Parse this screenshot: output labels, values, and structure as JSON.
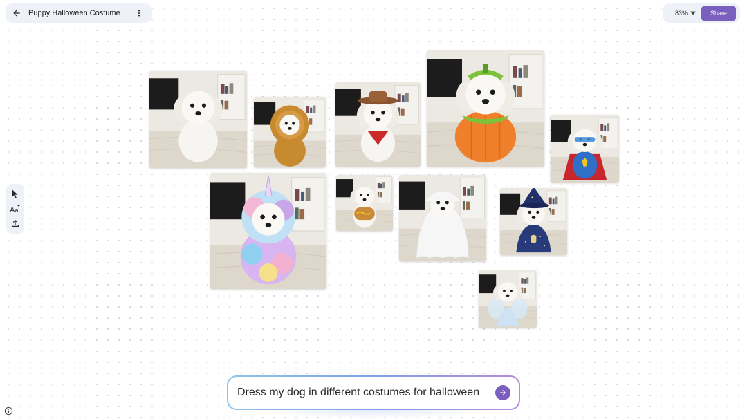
{
  "header": {
    "title": "Puppy Halloween Costume",
    "back_icon": "arrow-left-icon",
    "more_icon": "more-vert-icon"
  },
  "controls": {
    "zoom_label": "83%",
    "share_label": "Share"
  },
  "toolbar": {
    "tools": [
      "select-pointer-icon",
      "text-style-icon",
      "upload-icon"
    ]
  },
  "images": [
    {
      "costume": "plain",
      "accent": "#f2f0ec"
    },
    {
      "costume": "lion",
      "accent": "#c88a2e"
    },
    {
      "costume": "cowboy",
      "accent": "#cc2a2a"
    },
    {
      "costume": "pumpkin",
      "accent": "#ef7f2a"
    },
    {
      "costume": "superhero",
      "accent": "#2f6fc8"
    },
    {
      "costume": "unicorn",
      "accent": "#c9a6e8"
    },
    {
      "costume": "hotdog",
      "accent": "#c98a3a"
    },
    {
      "costume": "ghost",
      "accent": "#f6f6f6"
    },
    {
      "costume": "wizard",
      "accent": "#283a7a"
    },
    {
      "costume": "fairy",
      "accent": "#cfe2f3"
    }
  ],
  "prompt": {
    "value": "Dress my dog in different costumes for halloween"
  },
  "colors": {
    "accent": "#7b5fbf",
    "canvas": "#ffffff",
    "panel": "#eef1f8"
  }
}
